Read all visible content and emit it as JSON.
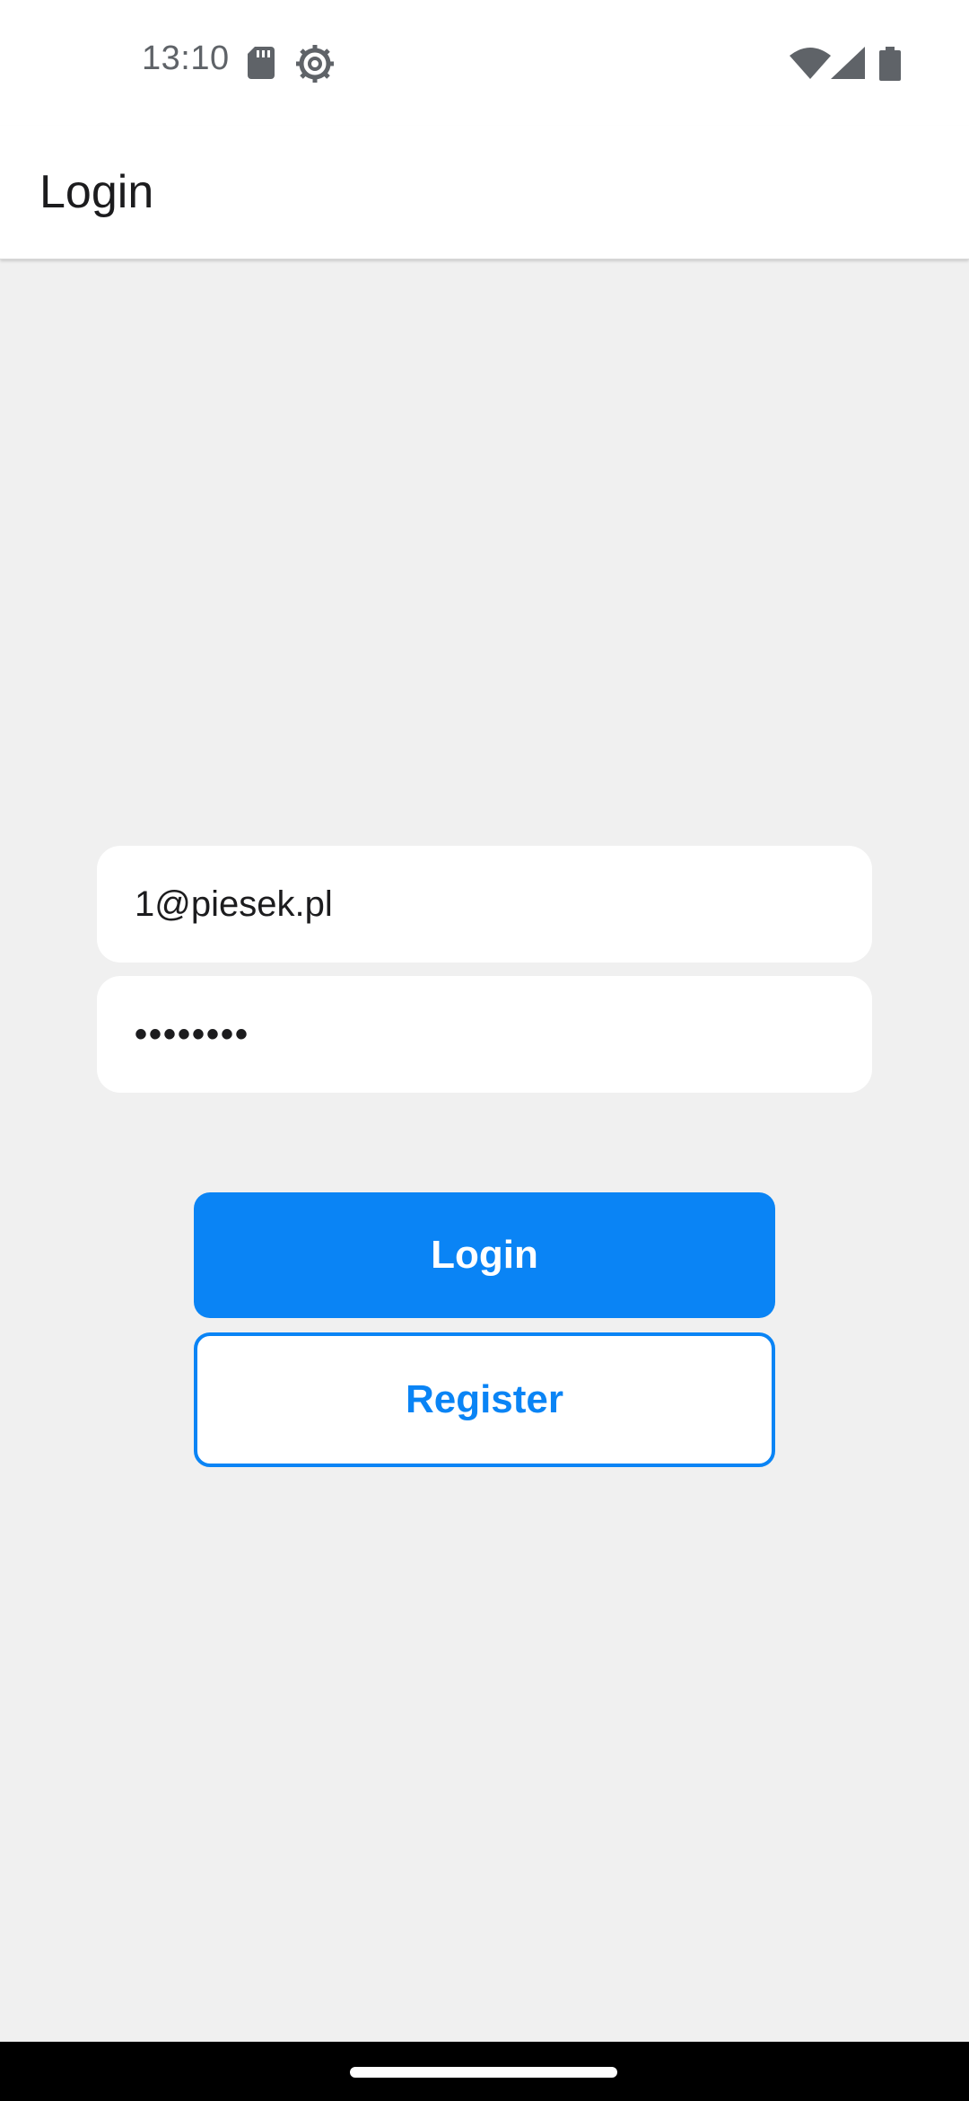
{
  "status_bar": {
    "time": "13:10",
    "icons": [
      "sd-card-icon",
      "settings-icon",
      "wifi-icon",
      "signal-icon",
      "battery-icon"
    ]
  },
  "app_bar": {
    "title": "Login"
  },
  "form": {
    "email_value": "1@piesek.pl",
    "password_value": "••••••••",
    "login_label": "Login",
    "register_label": "Register"
  },
  "colors": {
    "accent": "#0a84f5",
    "background": "#f0f0f0",
    "surface": "#ffffff"
  }
}
